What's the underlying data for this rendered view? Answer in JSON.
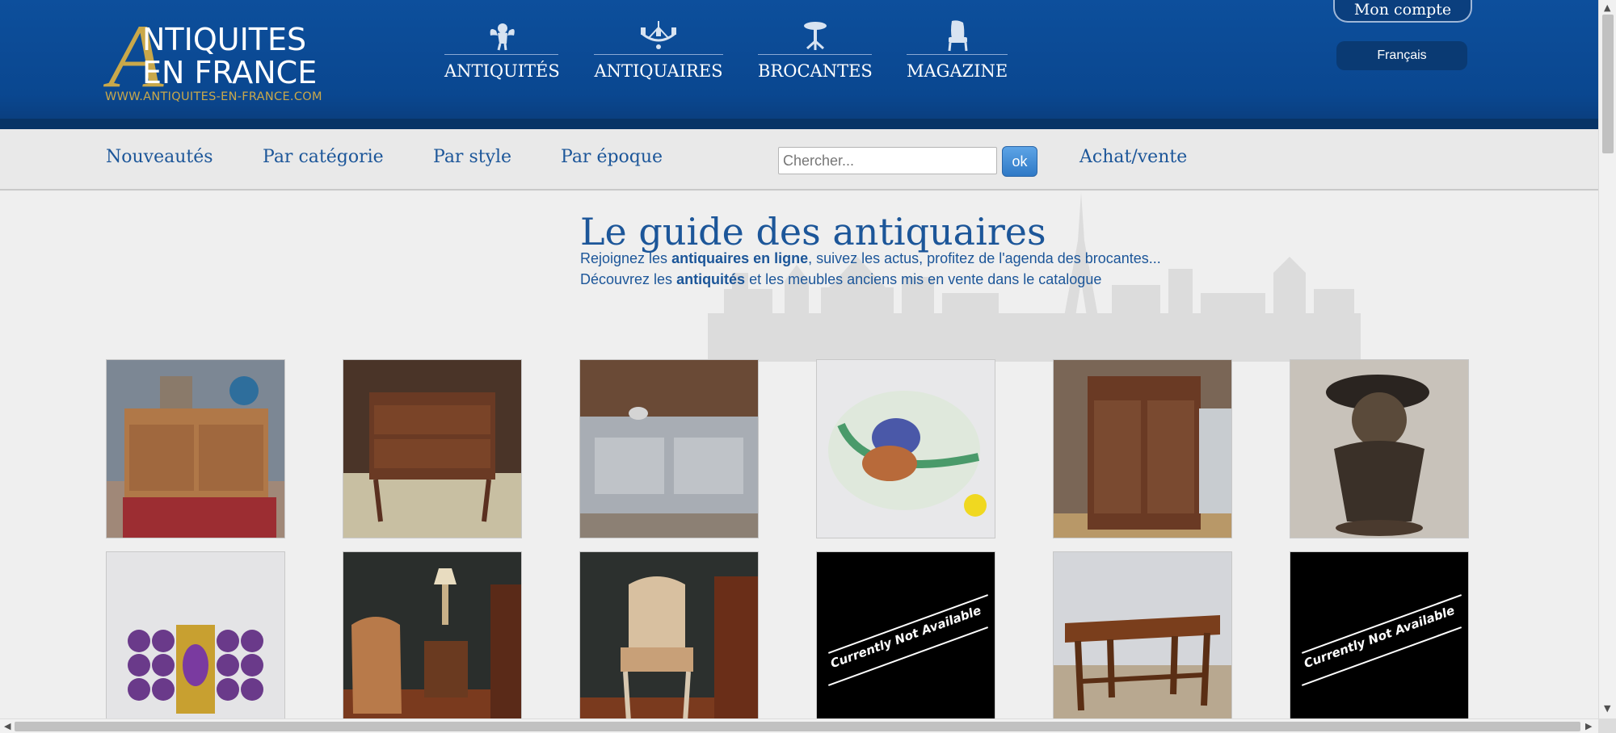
{
  "header": {
    "logo": {
      "big_letter": "A",
      "line1": "NTIQUITES",
      "line2": "EN FRANCE",
      "url": "WWW.ANTIQUITES-EN-FRANCE.COM"
    },
    "nav": [
      {
        "label": "ANTIQUITÉS",
        "icon": "cherub-icon"
      },
      {
        "label": "ANTIQUAIRES",
        "icon": "chandelier-icon"
      },
      {
        "label": "BROCANTES",
        "icon": "gueridon-table-icon"
      },
      {
        "label": "MAGAZINE",
        "icon": "armchair-icon"
      }
    ],
    "account_label": "Mon compte",
    "language": "Français"
  },
  "subnav": {
    "links": [
      "Nouveautés",
      "Par catégorie",
      "Par style",
      "Par époque"
    ],
    "search_placeholder": "Chercher...",
    "ok_label": "ok",
    "achat_vente": "Achat/vente"
  },
  "main": {
    "title": "Le guide des antiquaires",
    "intro1": {
      "a": "Rejoignez les ",
      "b": "antiquaires en ligne",
      "c": ", suivez les actus, profitez de l'agenda des brocantes..."
    },
    "intro2": {
      "a": "Découvrez les ",
      "b": "antiquités",
      "c": " et les meubles anciens mis en vente dans le catalogue"
    },
    "not_available_text": "Currently Not Available",
    "products": [
      {
        "kind": "sideboard",
        "available": true
      },
      {
        "kind": "commode",
        "available": true
      },
      {
        "kind": "buffet",
        "available": true
      },
      {
        "kind": "cat-plate",
        "available": true
      },
      {
        "kind": "armoire",
        "available": true
      },
      {
        "kind": "figurine",
        "available": true
      },
      {
        "kind": "bracelet",
        "available": true
      },
      {
        "kind": "chair-table",
        "available": true
      },
      {
        "kind": "chair",
        "available": true
      },
      {
        "kind": "not-available",
        "available": false
      },
      {
        "kind": "table",
        "available": true
      },
      {
        "kind": "not-available",
        "available": false
      }
    ]
  },
  "colors": {
    "header_blue": "#0d4f9c",
    "link_blue": "#1c5699",
    "gold": "#c9a84a"
  }
}
